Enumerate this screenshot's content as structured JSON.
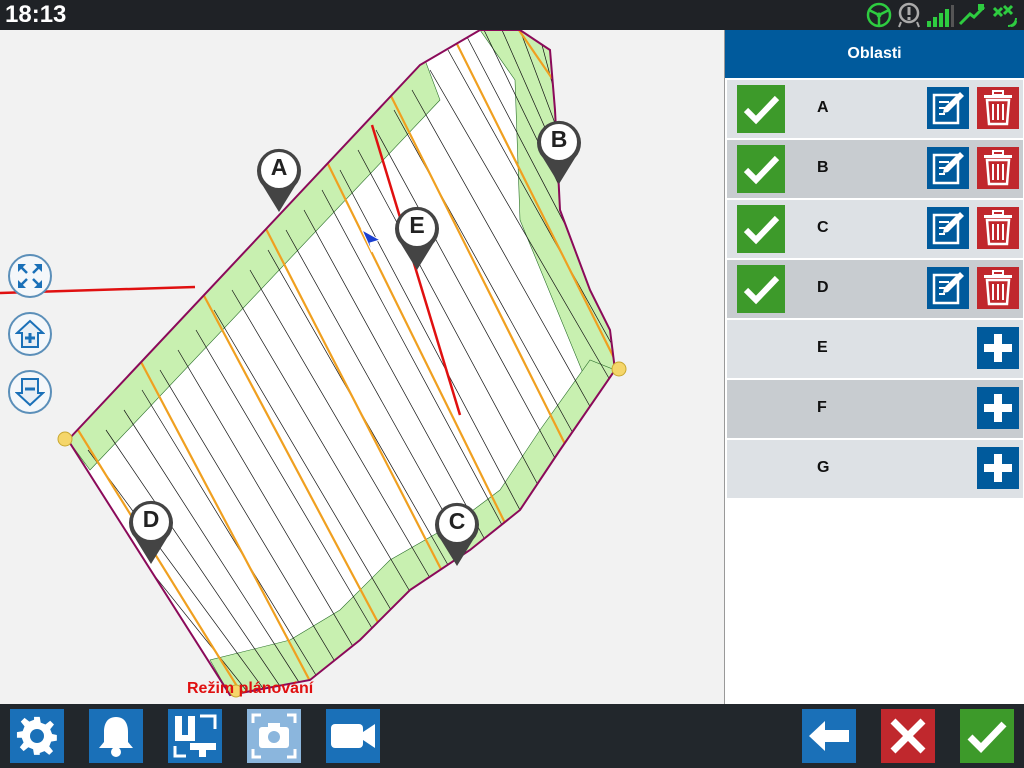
{
  "status_bar": {
    "time": "18:13",
    "icons": [
      "steering-wheel-icon",
      "alert-icon",
      "signal-icon",
      "gps-icon",
      "rtk-icon"
    ]
  },
  "map": {
    "mode_label": "Režim plánování",
    "pins": [
      "A",
      "B",
      "C",
      "D",
      "E"
    ],
    "controls": [
      "zoom-extents-icon",
      "zoom-in-icon",
      "zoom-out-icon"
    ]
  },
  "panel": {
    "title": "Oblasti",
    "rows": [
      {
        "label": "A",
        "active": true
      },
      {
        "label": "B",
        "active": true
      },
      {
        "label": "C",
        "active": true
      },
      {
        "label": "D",
        "active": true
      },
      {
        "label": "E",
        "active": false
      },
      {
        "label": "F",
        "active": false
      },
      {
        "label": "G",
        "active": false
      }
    ]
  },
  "bottom_bar": {
    "left_buttons": [
      "settings-icon",
      "bell-icon",
      "ut-icon",
      "screenshot-icon",
      "video-camera-icon"
    ],
    "right_buttons": [
      "back-arrow-icon",
      "cancel-icon",
      "confirm-icon"
    ]
  },
  "colors": {
    "accent_blue": "#005a9c",
    "active_green": "#3d9a2a",
    "delete_red": "#c0282d",
    "headland_green": "#c8f0b0",
    "guidance_orange": "#f0a020",
    "boundary_magenta": "#8b0a5a"
  }
}
